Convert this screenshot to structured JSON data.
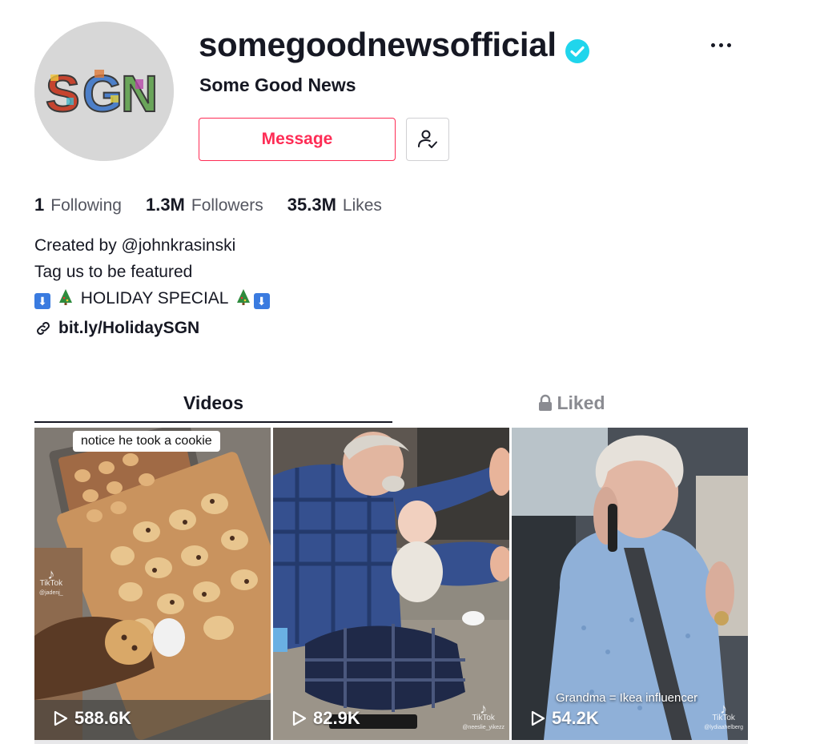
{
  "profile": {
    "username": "somegoodnewsofficial",
    "nickname": "Some Good News",
    "avatar_text": "SGN",
    "verified": true
  },
  "actions": {
    "message_label": "Message",
    "follow_icon": "user-check-icon",
    "more_icon": "more-horizontal-icon"
  },
  "stats": {
    "following_count": "1",
    "following_label": "Following",
    "followers_count": "1.3M",
    "followers_label": "Followers",
    "likes_count": "35.3M",
    "likes_label": "Likes"
  },
  "bio": {
    "line1": "Created by @johnkrasinski",
    "line2": "Tag us to be featured",
    "line3_text": "HOLIDAY SPECIAL",
    "link": "bit.ly/HolidaySGN"
  },
  "tabs": {
    "videos": "Videos",
    "liked": "Liked",
    "liked_icon": "lock-icon"
  },
  "videos": [
    {
      "views": "588.6K",
      "caption": "notice he took a cookie",
      "watermark": "TikTok",
      "watermark_user": "@jadenj_"
    },
    {
      "views": "82.9K",
      "caption": "",
      "watermark": "TikTok",
      "watermark_user": "@neeslie_yikezz"
    },
    {
      "views": "54.2K",
      "caption": "Grandma = Ikea influencer",
      "watermark": "TikTok",
      "watermark_user": "@lydiaahelberg"
    }
  ],
  "colors": {
    "accent": "#fe2c55",
    "verified": "#20d5ec",
    "text": "#161823",
    "muted": "#8a8b91"
  }
}
